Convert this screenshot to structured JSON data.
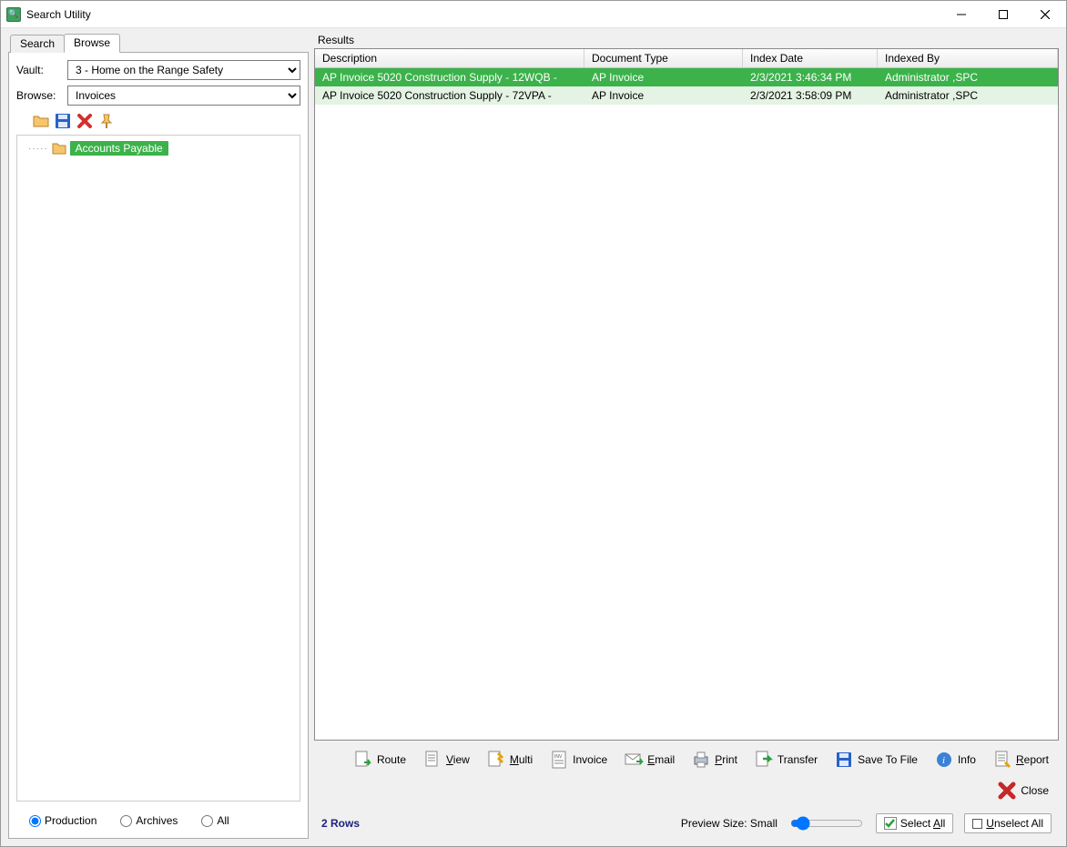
{
  "window": {
    "title": "Search Utility"
  },
  "tabs": {
    "search": "Search",
    "browse": "Browse",
    "active": "browse"
  },
  "left": {
    "vault_label": "Vault:",
    "vault_value": "3 - Home on the Range Safety",
    "browse_label": "Browse:",
    "browse_value": "Invoices",
    "tree": {
      "root": "Accounts Payable"
    },
    "scope": {
      "production": "Production",
      "archives": "Archives",
      "all": "All",
      "selected": "production"
    }
  },
  "results": {
    "label": "Results",
    "columns": {
      "description": "Description",
      "doc_type": "Document Type",
      "index_date": "Index Date",
      "indexed_by": "Indexed By"
    },
    "rows": [
      {
        "description": "AP Invoice 5020 Construction Supply - 12WQB -",
        "doc_type": "AP Invoice",
        "index_date": "2/3/2021 3:46:34 PM",
        "indexed_by": "Administrator ,SPC",
        "selected": true
      },
      {
        "description": "AP Invoice 5020 Construction Supply - 72VPA -",
        "doc_type": "AP Invoice",
        "index_date": "2/3/2021 3:58:09 PM",
        "indexed_by": "Administrator ,SPC",
        "selected": false
      }
    ]
  },
  "actions": {
    "route": "Route",
    "view": "View",
    "multi": "Multi",
    "invoice": "Invoice",
    "email": "Email",
    "print": "Print",
    "transfer": "Transfer",
    "save_to_file": "Save To File",
    "info": "Info",
    "report": "Report",
    "close": "Close"
  },
  "status": {
    "row_count": "2 Rows",
    "preview_label": "Preview Size: Small",
    "select_all": "Select All",
    "unselect_all": "Unselect All"
  }
}
